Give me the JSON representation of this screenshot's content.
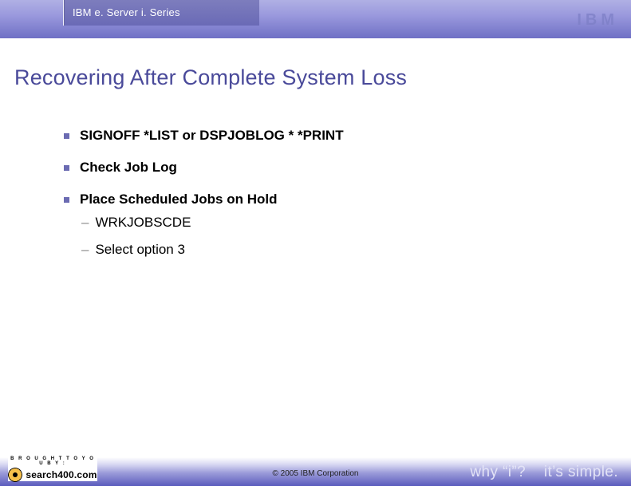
{
  "header": {
    "brand_line": "IBM e. Server i. Series",
    "logo_text": "IBM"
  },
  "title": "Recovering After Complete System Loss",
  "bullets": [
    {
      "text": "SIGNOFF  *LIST or DSPJOBLOG * *PRINT"
    },
    {
      "text": "Check Job Log"
    },
    {
      "text": "Place Scheduled Jobs on Hold",
      "sub": [
        "WRKJOBSCDE",
        "Select option 3"
      ]
    }
  ],
  "footer": {
    "copyright": "© 2005 IBM Corporation",
    "tagline_left": "why “i”?",
    "tagline_right": "it’s simple.",
    "brought_top": "B R O U G H T   T O   Y O U   B Y :",
    "brought_text": "search400.com"
  }
}
